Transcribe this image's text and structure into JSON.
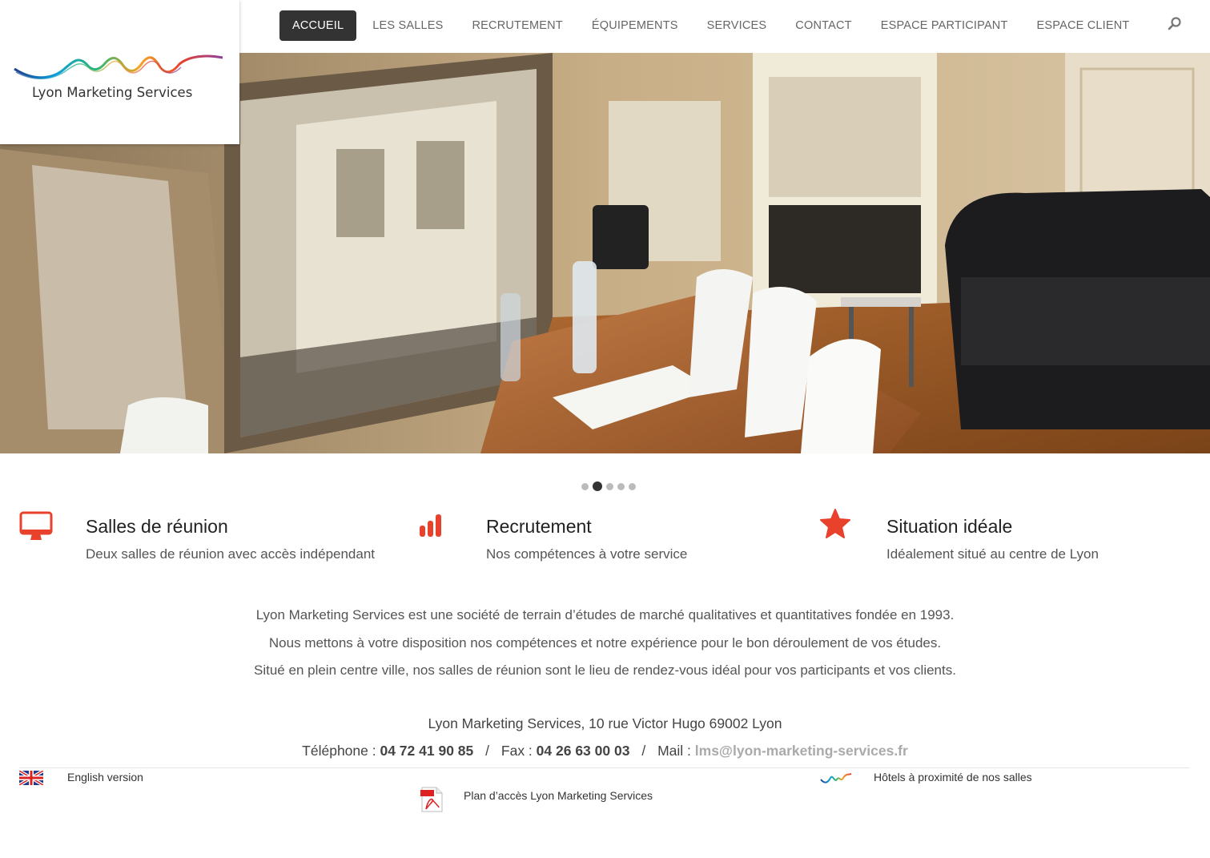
{
  "nav": {
    "items": [
      {
        "label": "ACCUEIL",
        "active": true
      },
      {
        "label": "LES SALLES",
        "active": false
      },
      {
        "label": "RECRUTEMENT",
        "active": false
      },
      {
        "label": "ÉQUIPEMENTS",
        "active": false
      },
      {
        "label": "SERVICES",
        "active": false
      },
      {
        "label": "CONTACT",
        "active": false
      },
      {
        "label": "ESPACE PARTICIPANT",
        "active": false
      },
      {
        "label": "ESPACE CLIENT",
        "active": false
      }
    ],
    "search_icon": "search-icon"
  },
  "logo": {
    "text": "Lyon Marketing Services"
  },
  "slider": {
    "count": 5,
    "active_index": 1
  },
  "features": [
    {
      "icon": "monitor-icon",
      "title": "Salles de réunion",
      "desc": "Deux salles de réunion avec accès indépendant"
    },
    {
      "icon": "bar-chart-icon",
      "title": "Recrutement",
      "desc": "Nos compétences à votre service"
    },
    {
      "icon": "star-icon",
      "title": "Situation idéale",
      "desc": "Idéalement situé au centre de Lyon"
    }
  ],
  "about": {
    "line1": "Lyon Marketing Services est une société de terrain d’études de marché qualitatives et quantitatives fondée en 1993.",
    "line2": "Nous mettons à votre disposition nos compétences et notre expérience pour le bon déroulement de vos études.",
    "line3": "Situé en plein centre ville, nos salles de réunion sont le lieu de rendez-vous idéal pour vos participants et vos clients."
  },
  "contact": {
    "address": "Lyon Marketing Services, 10 rue Victor Hugo 69002 Lyon",
    "phone_label": "Téléphone :",
    "phone": "04 72 41 90 85",
    "fax_label": "Fax :",
    "fax": "04 26 63 00 03",
    "mail_label": "Mail :",
    "mail": "lms@lyon-marketing-services.fr",
    "separator": "/"
  },
  "footer": {
    "english": "English version",
    "plan": "Plan d’accès Lyon Marketing Services",
    "hotels": "Hôtels à proximité de nos salles"
  },
  "colors": {
    "accent": "#e8412c",
    "nav_active": "#333333"
  }
}
